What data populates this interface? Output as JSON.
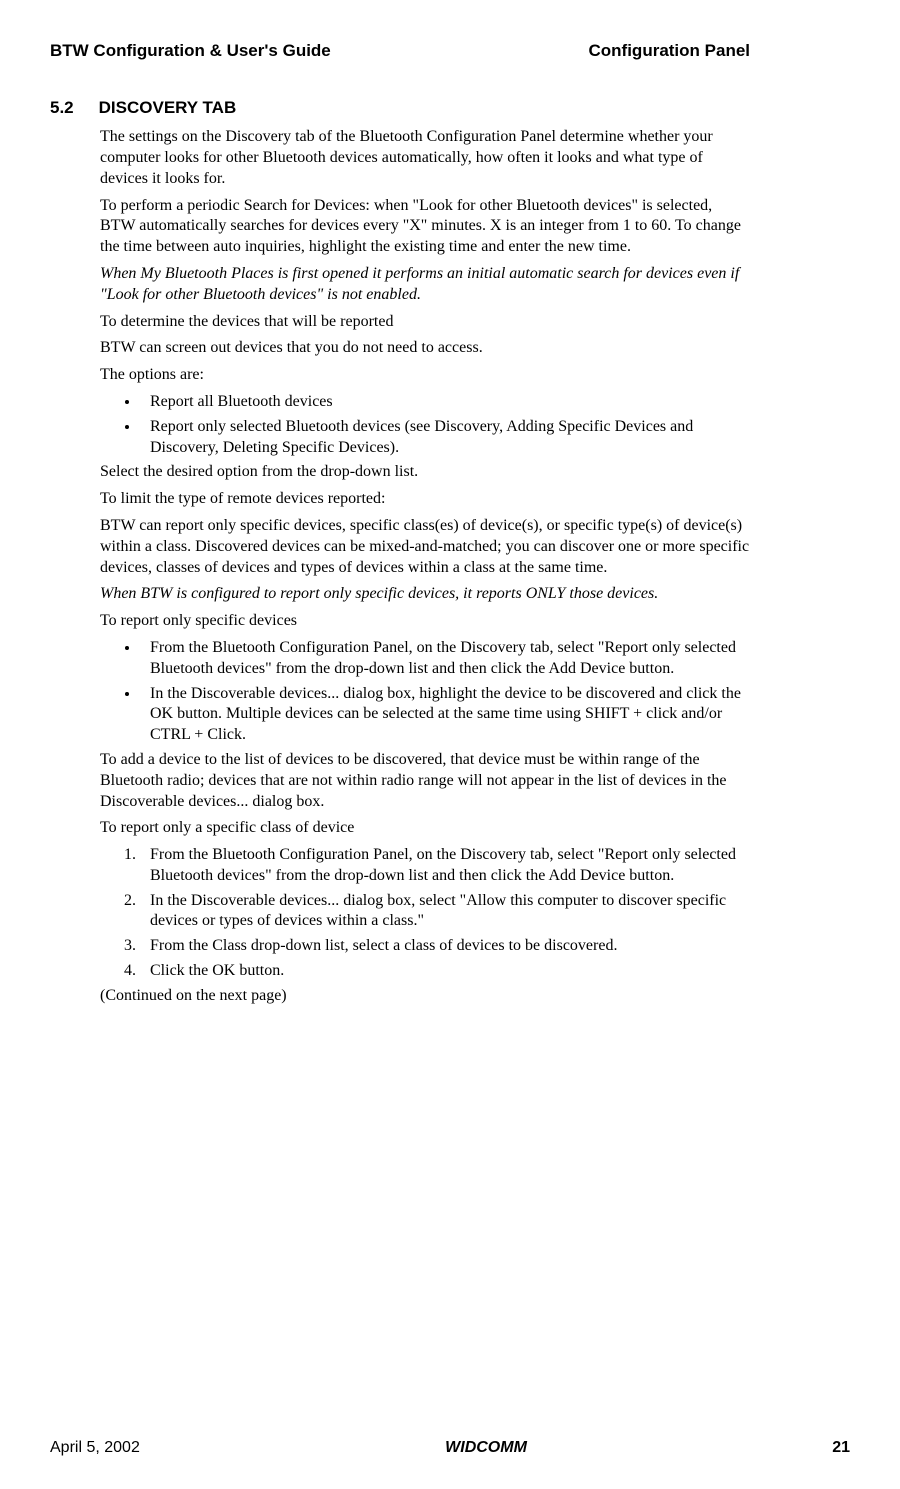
{
  "header": {
    "left": "BTW Configuration & User's Guide",
    "right": "Configuration Panel"
  },
  "section": {
    "number": "5.2",
    "title": "DISCOVERY TAB"
  },
  "paragraphs": {
    "p1": "The settings on the Discovery tab of the Bluetooth Configuration Panel determine whether your computer looks for other Bluetooth devices automatically, how often it looks and what type of devices it looks for.",
    "p2": "To perform a periodic Search for Devices: when \"Look for other Bluetooth devices\" is selected, BTW automatically searches for devices every \"X\" minutes. X is an integer from 1 to 60. To change the time between auto inquiries, highlight the existing time and enter the new time.",
    "p3": "When My Bluetooth Places is first opened it performs an initial automatic search for devices even if \"Look for other Bluetooth devices\" is not enabled.",
    "p4": "To determine the devices that will be reported",
    "p5": "BTW can screen out devices that you do not need to access.",
    "p6": "The options are:",
    "p7": "Select the desired option from the drop-down list.",
    "p8": "To limit the type of remote devices reported:",
    "p9": "BTW can report only specific devices, specific class(es) of device(s), or specific type(s) of device(s) within a class. Discovered devices can be mixed-and-matched; you can discover one or more specific devices, classes of devices and types of devices within a class at the same time.",
    "p10": "When BTW is configured to report only specific devices, it reports ONLY those devices.",
    "p11": "To report only specific devices",
    "p12": "To add a device to the list of devices to be discovered, that device must be within range of the Bluetooth radio; devices that are not within radio range will not appear in the list of devices in the Discoverable devices... dialog box.",
    "p13": "To report only a specific class of device",
    "p14": "(Continued on the next page)"
  },
  "list1": {
    "item1": "Report all Bluetooth devices",
    "item2": "Report only selected Bluetooth devices (see Discovery, Adding Specific Devices and Discovery, Deleting Specific Devices)."
  },
  "list2": {
    "item1": "From the Bluetooth Configuration Panel, on the Discovery tab, select \"Report only selected Bluetooth devices\" from the drop-down list and then click the Add Device button.",
    "item2": "In the Discoverable devices... dialog box, highlight the device to be discovered and click the OK button. Multiple devices can be selected at the same time using SHIFT + click and/or CTRL + Click."
  },
  "list3": {
    "item1": "From the Bluetooth Configuration Panel, on the Discovery tab, select \"Report only selected Bluetooth devices\" from the drop-down list and then click the Add Device button.",
    "item2": "In the Discoverable devices... dialog box, select \"Allow this computer to discover specific devices or types of devices within a class.\"",
    "item3": "From the Class drop-down list, select a class of devices to be discovered.",
    "item4": "Click the OK button."
  },
  "footer": {
    "left": "April 5, 2002",
    "center": "WIDCOMM",
    "right": "21"
  }
}
